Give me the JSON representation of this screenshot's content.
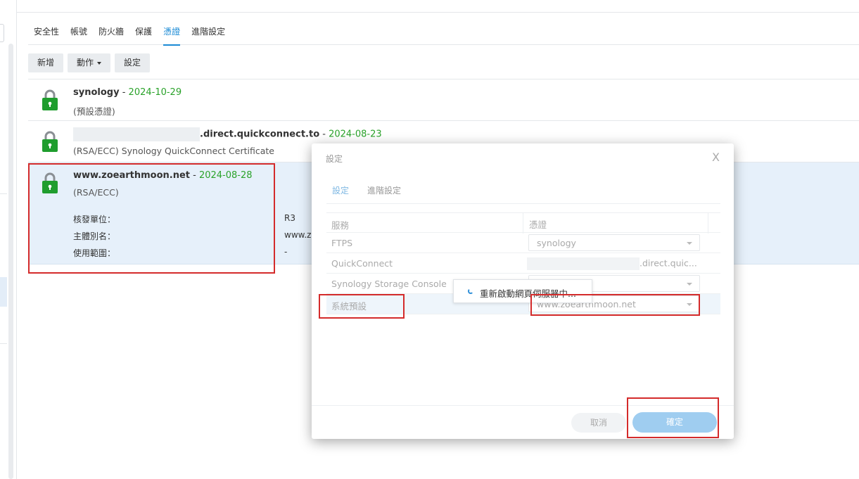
{
  "tabs": [
    {
      "label": "安全性"
    },
    {
      "label": "帳號"
    },
    {
      "label": "防火牆"
    },
    {
      "label": "保護"
    },
    {
      "label": "憑證"
    },
    {
      "label": "進階設定"
    }
  ],
  "active_tab": "憑證",
  "toolbar": {
    "add_label": "新增",
    "action_label": "動作",
    "settings_label": "設定"
  },
  "certificates": [
    {
      "domain": "synology",
      "separator": " - ",
      "date": "2024-10-29",
      "subtitle": "(預設憑證)"
    },
    {
      "domain": ".direct.quickconnect.to",
      "separator": " - ",
      "date": "2024-08-23",
      "subtitle": "(RSA/ECC) Synology QuickConnect Certificate"
    },
    {
      "domain": "www.zoearthmoon.net",
      "separator": " - ",
      "date": "2024-08-28",
      "subtitle": "(RSA/ECC)",
      "details": [
        {
          "label": "核發單位：",
          "value": "R3"
        },
        {
          "label": "主體別名：",
          "value": "www.z"
        },
        {
          "label": "使用範圍：",
          "value": "-"
        }
      ]
    }
  ],
  "dialog": {
    "title": "設定",
    "close": "X",
    "tabs": [
      {
        "label": "設定"
      },
      {
        "label": "進階設定"
      }
    ],
    "columns": {
      "service": "服務",
      "certificate": "憑證"
    },
    "rows": [
      {
        "service": "FTPS",
        "certificate": "synology"
      },
      {
        "service": "QuickConnect",
        "certificate": ".direct.quic..."
      },
      {
        "service": "Synology Storage Console",
        "certificate": ""
      },
      {
        "service": "系統預設",
        "certificate": "www.zoearthmoon.net"
      }
    ],
    "cancel_label": "取消",
    "ok_label": "確定"
  },
  "toast": {
    "message": "重新啟動網頁伺服器中..."
  },
  "colors": {
    "accent": "#1a8ad5",
    "date_green": "#2aa22a",
    "highlight_red": "#d42b2b",
    "lock_green": "#1f9d2e",
    "selected_row": "#e6f0fa"
  }
}
